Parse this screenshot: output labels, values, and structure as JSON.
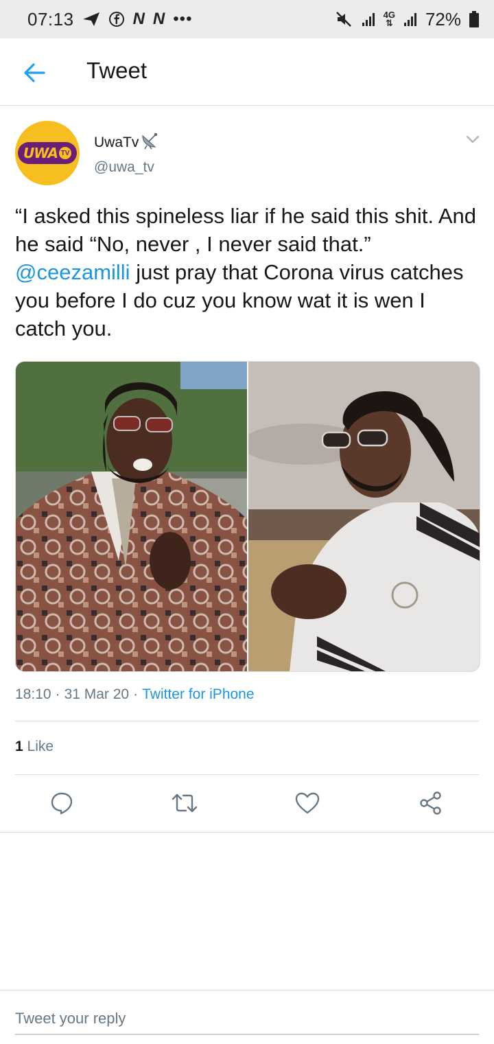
{
  "status_bar": {
    "time": "07:13",
    "network_letters": [
      "N",
      "N"
    ],
    "more": "•••",
    "network_type": "4G",
    "battery": "72%"
  },
  "header": {
    "title": "Tweet"
  },
  "tweet": {
    "avatar_logo": "UWA",
    "avatar_logo_tv": "TV",
    "display_name": "UwaTv",
    "handle": "@uwa_tv",
    "text_part1": "“I asked this spineless liar if he said this shit. And he said “No, never , I never said that.” ",
    "mention": "@ceezamilli",
    "text_part2": " just pray that Corona virus catches you before I do cuz you know wat it is wen I catch you.",
    "time": "18:10",
    "date": "31 Mar 20",
    "separator": "·",
    "source": "Twitter for iPhone",
    "like_count": "1",
    "like_label": "Like"
  },
  "reply": {
    "placeholder": "Tweet your reply"
  },
  "colors": {
    "accent": "#1b95e0",
    "muted": "#657786",
    "avatar_bg": "#f6be1f",
    "logo_purple": "#6a1e7a"
  },
  "icons": {
    "back": "arrow-left-icon",
    "caret": "chevron-down-icon",
    "reply": "comment-icon",
    "retweet": "retweet-icon",
    "like": "heart-icon",
    "share": "share-icon",
    "verified_badge": "satellite-dish-icon"
  }
}
